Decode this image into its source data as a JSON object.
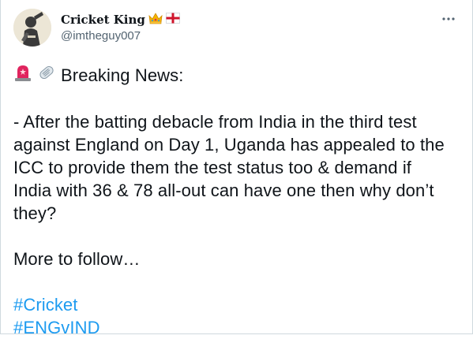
{
  "tweet": {
    "author": {
      "display_name": "Cricket King",
      "handle": "@imtheguy007",
      "name_emojis": [
        "crown-emoji",
        "england-flag-emoji"
      ]
    },
    "more_icon": "more-dots-icon",
    "heading_emojis": [
      "rotating-light-emoji",
      "newspaper-emoji"
    ],
    "heading": "Breaking News:",
    "body_lines": [
      "- After the batting debacle from India in the third test",
      "against England on Day 1, Uganda has appealed to the",
      "ICC to provide them the test status too & demand if",
      "India with 36 & 78 all-out can have one then why don’t",
      "they?"
    ],
    "follow_text": "More to follow…",
    "hashtags": [
      "#Cricket",
      "#ENGvIND"
    ],
    "colors": {
      "text": "#0f1419",
      "secondary": "#536471",
      "link": "#1d9bf0",
      "border": "#cfd9de"
    }
  }
}
